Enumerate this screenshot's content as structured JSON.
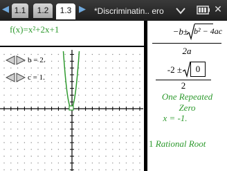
{
  "titlebar": {
    "prev_icon": "chevron-left-icon",
    "next_icon": "chevron-right-icon",
    "tabs": [
      {
        "label": "1.1",
        "active": false
      },
      {
        "label": "1.2",
        "active": false
      },
      {
        "label": "1.3",
        "active": true
      }
    ],
    "document_title": "*Discriminatin.. ero",
    "menu_icon": "chevron-down-icon",
    "battery_icon": "battery-icon",
    "close_icon": "close-icon",
    "close_glyph": "✕"
  },
  "graph": {
    "function_label": "f(x)=x²+2x+1",
    "sliders": [
      {
        "name": "b",
        "label": "b = 2."
      },
      {
        "name": "c",
        "label": "c = 1."
      }
    ],
    "colors": {
      "curve": "#2e9a2e",
      "axes": "#000000"
    }
  },
  "notes": {
    "formula_numerator_prefix": "−b±",
    "formula_radicand": "b² − 4ac",
    "formula_denominator": "2a",
    "computed_numerator_prefix": "-2 ±",
    "computed_radicand": "0",
    "computed_denominator": "2",
    "result_line1": "One Repeated",
    "result_line2": "Zero",
    "result_line3": "x = -1.",
    "root_count": "1",
    "root_text": "Rational Root"
  }
}
